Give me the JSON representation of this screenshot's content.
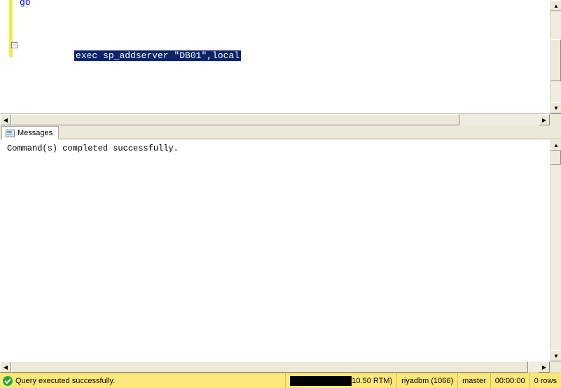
{
  "editor": {
    "line1": "go",
    "line2_pre": "exec",
    "line2_proc": " sp_addserver ",
    "line2_arg": "\"DB01\",local"
  },
  "tabs": {
    "messages": "Messages"
  },
  "results": {
    "message": "Command(s) completed successfully."
  },
  "status": {
    "text": "Query executed successfully.",
    "version": "10.50 RTM)",
    "user": "riyadbm (1066)",
    "database": "master",
    "elapsed": "00:00:00",
    "rows": "0 rows"
  }
}
